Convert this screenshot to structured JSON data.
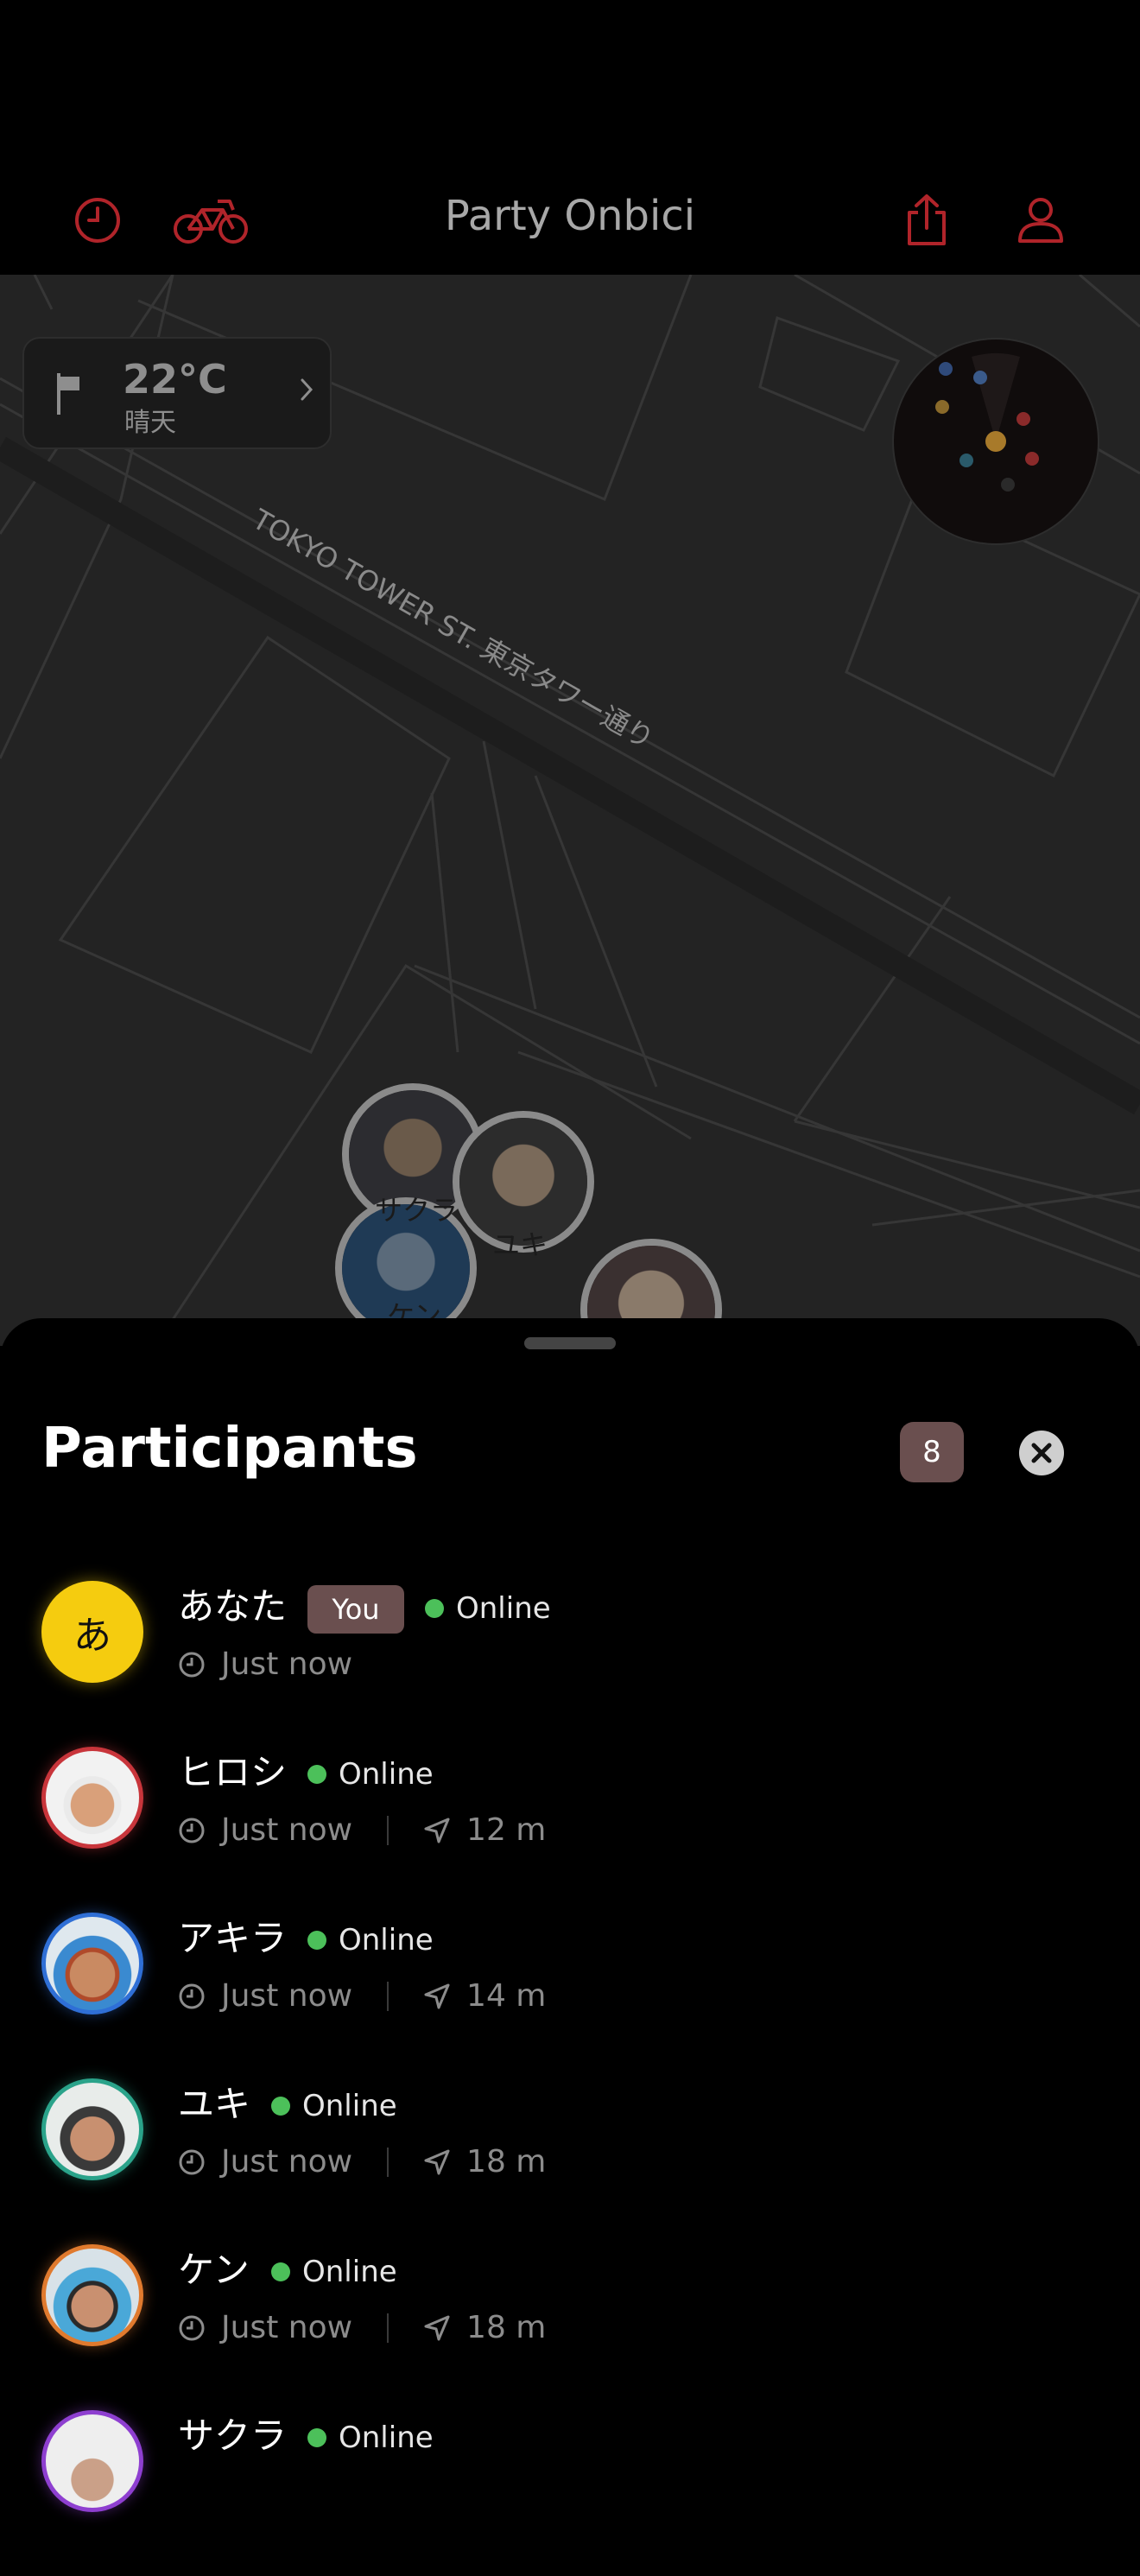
{
  "header": {
    "title": "Party Onbici",
    "accent": "#b0242a"
  },
  "map": {
    "weather": {
      "temp": "22°C",
      "condition": "晴天"
    },
    "street_label": "TOKYO TOWER ST. 東京タワー通り",
    "pins": [
      {
        "label": "サクラ"
      },
      {
        "label": "ユキ"
      },
      {
        "label": "ケン"
      }
    ]
  },
  "sheet": {
    "title": "Participants",
    "count": "8"
  },
  "participants": [
    {
      "name": "あなた",
      "avatar_text": "あ",
      "you_badge": "You",
      "status": "Online",
      "time": "Just now",
      "distance": ""
    },
    {
      "name": "ヒロシ",
      "status": "Online",
      "time": "Just now",
      "distance": "12 m",
      "ring": "#c8353b"
    },
    {
      "name": "アキラ",
      "status": "Online",
      "time": "Just now",
      "distance": "14 m",
      "ring": "#2f6fd6"
    },
    {
      "name": "ユキ",
      "status": "Online",
      "time": "Just now",
      "distance": "18 m",
      "ring": "#2aa38a"
    },
    {
      "name": "ケン",
      "status": "Online",
      "time": "Just now",
      "distance": "18 m",
      "ring": "#e07a2e"
    },
    {
      "name": "サクラ",
      "status": "Online",
      "time": "",
      "distance": "",
      "ring": "#8e3fd0"
    }
  ]
}
